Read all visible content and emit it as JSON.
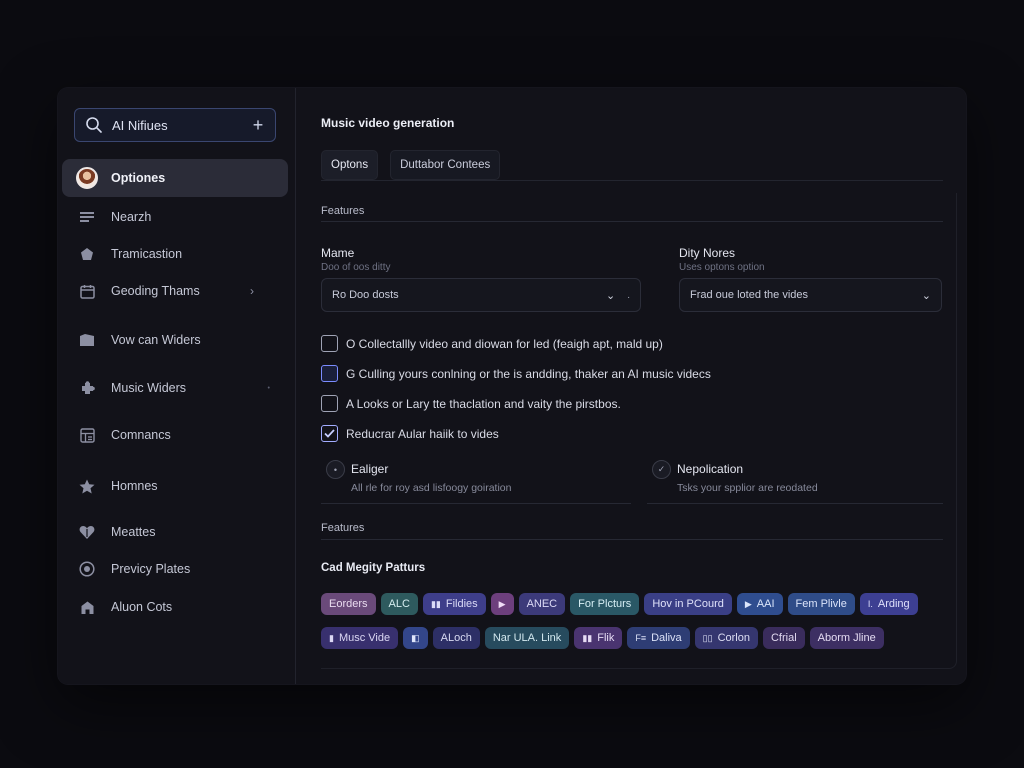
{
  "sidebar": {
    "search_text": "AI Nifiues",
    "items": [
      {
        "label": "Optiones",
        "icon": "avatar",
        "active": true
      },
      {
        "label": "Nearzh",
        "icon": "list-icon"
      },
      {
        "label": "Tramicastion",
        "icon": "pentagon-icon"
      },
      {
        "label": "Geoding Thams",
        "icon": "calendar-icon",
        "chevron": "›"
      },
      {
        "label": "Vow can Widers",
        "icon": "folder-icon"
      },
      {
        "label": "Music Widers",
        "icon": "puzzle-icon",
        "chevron": "•"
      },
      {
        "label": "Comnancs",
        "icon": "grid-icon"
      },
      {
        "label": "Homnes",
        "icon": "star-icon"
      },
      {
        "label": "Meattes",
        "icon": "heart-icon"
      },
      {
        "label": "Previcy Plates",
        "icon": "target-icon"
      },
      {
        "label": "Aluon Cots",
        "icon": "house-icon"
      }
    ]
  },
  "main": {
    "title": "Music video generation",
    "tabs": [
      {
        "label": "Optons",
        "active": true
      },
      {
        "label": "Duttabor Contees",
        "active": false
      }
    ],
    "features_label": "Features",
    "name_field": {
      "label": "Mame",
      "hint": "Doo of oos ditty",
      "value": "Ro Doo dosts"
    },
    "duty_field": {
      "label": "Dity Nores",
      "hint": "Uses optons option",
      "value": "Frad oue loted the vides"
    },
    "checkboxes": [
      {
        "label": "O Collectallly video and diowan for led (feaigh apt, mald up)",
        "state": "unchecked"
      },
      {
        "label": "G Culling yours conlning or the is andding, thaker an AI music videcs",
        "state": "focused"
      },
      {
        "label": "A Looks or Lary tte thaclation and vaity the pirstbos.",
        "state": "unchecked"
      },
      {
        "label": "Reducrar Aular haiik to vides",
        "state": "checked"
      }
    ],
    "radios": [
      {
        "title": "Ealiger",
        "desc": "All rle for roy asd lisfoogy goiration",
        "mark": "•"
      },
      {
        "title": "Nepolication",
        "desc": "Tsks your spplior are reodated",
        "mark": "✓"
      }
    ],
    "features2_label": "Features",
    "patterns_title": "Cad Megity Patturs",
    "chip_rows": [
      [
        {
          "label": "Eorders",
          "bg": "#6a4a7a",
          "fg": "#eadcf0",
          "icon": ""
        },
        {
          "label": "ALC",
          "bg": "#2e5a5e",
          "fg": "#d5ecee",
          "icon": ""
        },
        {
          "label": "Fildies",
          "bg": "#3e3e8a",
          "fg": "#dcdcf8",
          "icon": "▮▮"
        },
        {
          "label": "",
          "bg": "#6d3f7d",
          "fg": "#f0dcf6",
          "icon": "▶"
        },
        {
          "label": "ANEC",
          "bg": "#3c3a7a",
          "fg": "#dcdaf6",
          "icon": ""
        },
        {
          "label": "For Plcturs",
          "bg": "#2a5866",
          "fg": "#d6eef4",
          "icon": ""
        },
        {
          "label": "Hov in PCourd",
          "bg": "#3a3f86",
          "fg": "#e0e2fa",
          "icon": ""
        },
        {
          "label": "AAI",
          "bg": "#2f4d8f",
          "fg": "#dbe6fb",
          "icon": "▶"
        },
        {
          "label": "Fem Plivle",
          "bg": "#2f4c88",
          "fg": "#dbe4fa",
          "icon": ""
        },
        {
          "label": "Arding",
          "bg": "#3d3f92",
          "fg": "#dfe0fb",
          "icon": "I."
        }
      ],
      [
        {
          "label": "Musc Vide",
          "bg": "#38306e",
          "fg": "#dcd8f4",
          "icon": "▮"
        },
        {
          "label": "",
          "bg": "#33468a",
          "fg": "#dfe6fb",
          "icon": "◧"
        },
        {
          "label": "ALoch",
          "bg": "#2d2f66",
          "fg": "#d8daf2",
          "icon": ""
        },
        {
          "label": "Nar ULA. Link",
          "bg": "#274b5e",
          "fg": "#d3e8ef",
          "icon": ""
        },
        {
          "label": "Flik",
          "bg": "#4a3470",
          "fg": "#e6dbf4",
          "icon": "▮▮"
        },
        {
          "label": "Daliva",
          "bg": "#2e3d74",
          "fg": "#dbe1f7",
          "icon": "F≡"
        },
        {
          "label": "Corlon",
          "bg": "#35366f",
          "fg": "#dedff4",
          "icon": "▯▯"
        },
        {
          "label": "Cfrial",
          "bg": "#3a2c5c",
          "fg": "#e2d9f0",
          "icon": ""
        },
        {
          "label": "Aborm Jline",
          "bg": "#3d2f63",
          "fg": "#e4dbf2",
          "icon": ""
        }
      ]
    ]
  }
}
